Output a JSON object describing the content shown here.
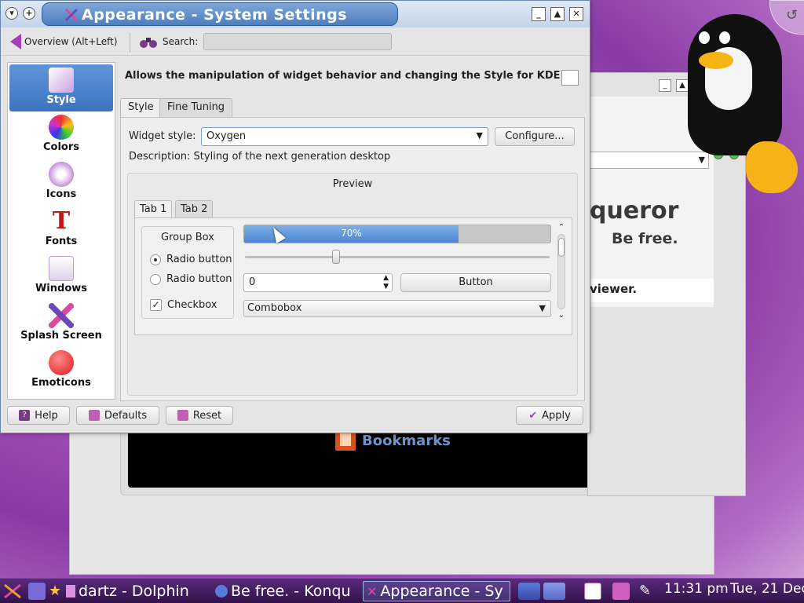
{
  "main_window": {
    "title": "Appearance - System Settings",
    "toolbar": {
      "overview_label": "Overview (Alt+Left)",
      "search_label": "Search:",
      "search_value": ""
    },
    "sidebar": {
      "items": [
        {
          "label": "Style",
          "icon": "style-icon",
          "active": true
        },
        {
          "label": "Colors",
          "icon": "colors-icon",
          "active": false
        },
        {
          "label": "Icons",
          "icon": "icons-icon",
          "active": false
        },
        {
          "label": "Fonts",
          "icon": "fonts-icon",
          "active": false
        },
        {
          "label": "Windows",
          "icon": "windows-icon",
          "active": false
        },
        {
          "label": "Splash Screen",
          "icon": "splash-screen-icon",
          "active": false
        },
        {
          "label": "Emoticons",
          "icon": "emoticons-icon",
          "active": false
        }
      ]
    },
    "header": "Allows the manipulation of widget behavior and changing the Style for KDE",
    "tabs": [
      {
        "label": "Style",
        "active": true
      },
      {
        "label": "Fine Tuning",
        "active": false
      }
    ],
    "style_tab": {
      "widget_style_label": "Widget style:",
      "widget_style_value": "Oxygen",
      "configure_label": "Configure...",
      "description": "Description: Styling of the next generation desktop"
    },
    "preview": {
      "title": "Preview",
      "tabs": [
        {
          "label": "Tab 1",
          "active": true
        },
        {
          "label": "Tab 2",
          "active": false
        }
      ],
      "group_box_title": "Group Box",
      "radio1_label": "Radio button",
      "radio1_checked": true,
      "radio2_label": "Radio button",
      "radio2_checked": false,
      "checkbox_label": "Checkbox",
      "checkbox_checked": true,
      "progress_text": "70%",
      "progress_value": 0.7,
      "slider_value": 0.3,
      "spinbox_value": "0",
      "button_label": "Button",
      "combobox_value": "Combobox"
    },
    "buttons": {
      "help": "Help",
      "defaults": "Defaults",
      "reset": "Reset",
      "apply": "Apply"
    }
  },
  "background": {
    "konqueror_title_fragment": "queror",
    "konqueror_tagline": "Be free.",
    "viewer_text": "viewer.",
    "bookmarks_label": "Bookmarks"
  },
  "taskbar": {
    "tasks": [
      {
        "label": "dartz - Dolphin",
        "active": false
      },
      {
        "label": "Be free. - Konqu",
        "active": false
      },
      {
        "label": "Appearance - Sy",
        "active": true
      }
    ],
    "clock": "11:31 pm",
    "date": "Tue, 21 Dec"
  },
  "colors": {
    "accent": "#4a86d2",
    "desktop": "#a454b8",
    "taskbar": "#3c1a56"
  }
}
